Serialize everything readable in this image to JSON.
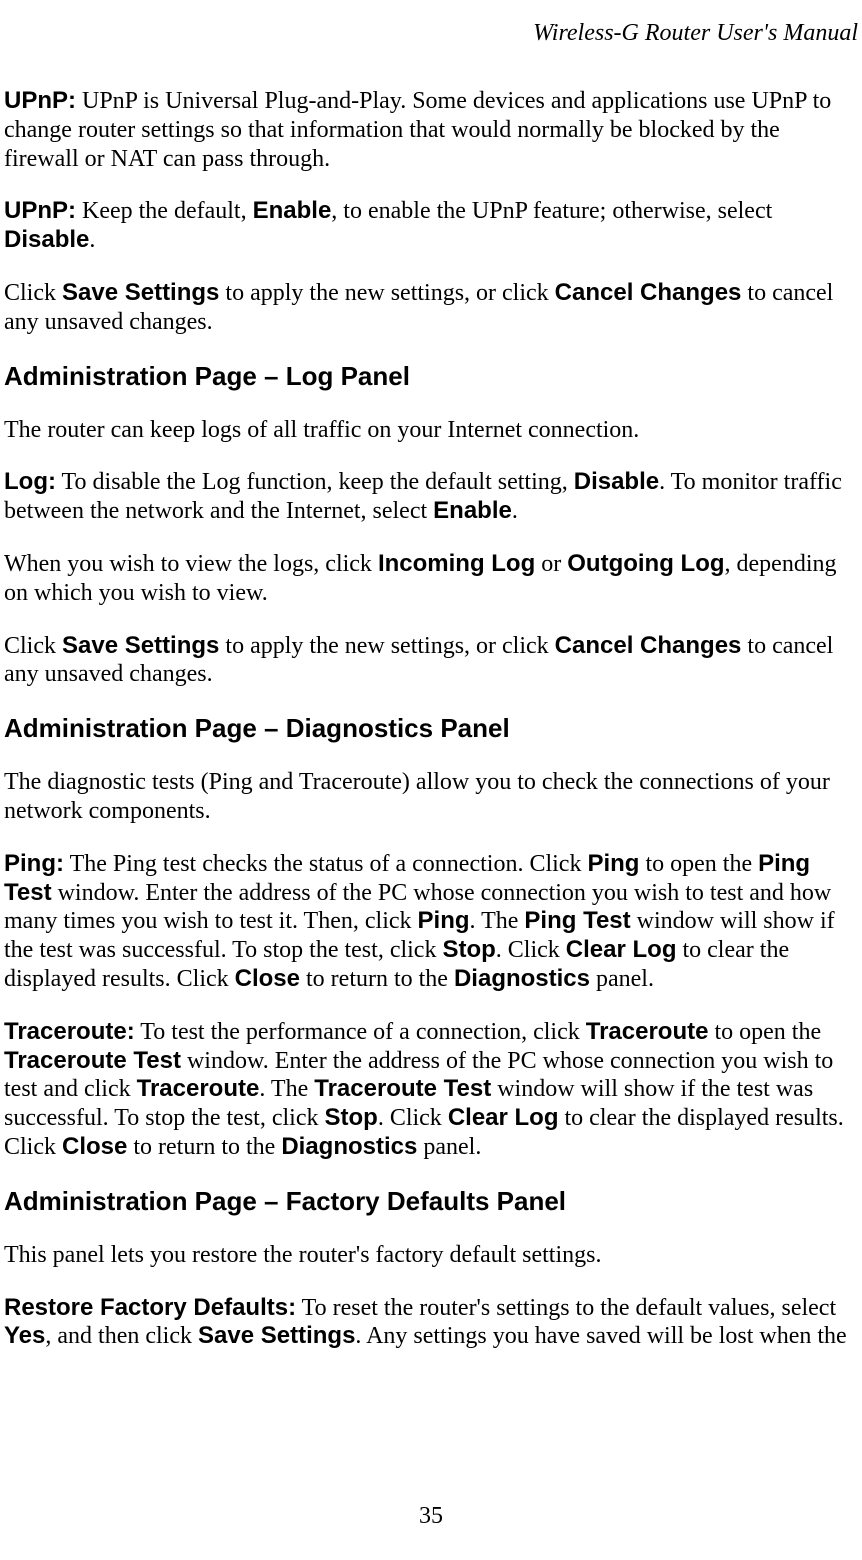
{
  "header": {
    "title": "Wireless-G Router User's Manual"
  },
  "paragraphs": {
    "p1": {
      "label": "UPnP:",
      "text": " UPnP is Universal Plug-and-Play. Some devices and applications use UPnP to change router settings so that information that would normally be blocked by the firewall or NAT can pass through."
    },
    "p2": {
      "label": "UPnP:",
      "t1": " Keep the default, ",
      "b1": "Enable",
      "t2": ", to enable the UPnP feature; otherwise, select ",
      "b2": "Disable",
      "t3": "."
    },
    "p3": {
      "t1": "Click ",
      "b1": "Save Settings",
      "t2": " to apply the new settings, or click ",
      "b2": "Cancel Changes",
      "t3": " to cancel any unsaved changes."
    },
    "h1": "Administration Page – Log Panel",
    "p4": "The router can keep logs of all traffic on your Internet connection.",
    "p5": {
      "label": "Log:",
      "t1": " To disable the Log function, keep the default setting, ",
      "b1": "Disable",
      "t2": ". To monitor traffic between the network and the Internet, select ",
      "b2": "Enable",
      "t3": "."
    },
    "p6": {
      "t1": "When you wish to view the logs, click ",
      "b1": "Incoming Log",
      "t2": " or ",
      "b2": "Outgoing Log",
      "t3": ", depending on which you wish to view."
    },
    "p7": {
      "t1": "Click ",
      "b1": "Save Settings",
      "t2": " to apply the new settings, or click ",
      "b2": "Cancel Changes",
      "t3": " to cancel any unsaved changes."
    },
    "h2": "Administration Page – Diagnostics Panel",
    "p8": "The diagnostic tests (Ping and Traceroute) allow you to check the connections of your network components.",
    "p9": {
      "label": "Ping:",
      "t1": " The Ping test checks the status of a connection. Click ",
      "b1": "Ping",
      "t2": " to open the ",
      "b2": "Ping Test",
      "t3": " window. Enter the address of the PC whose connection you wish to test and how many times you wish to test it. Then, click ",
      "b3": "Ping",
      "t4": ". The ",
      "b4": "Ping Test",
      "t5": " window will show if the test was successful. To stop the test, click ",
      "b5": "Stop",
      "t6": ". Click ",
      "b6": "Clear Log",
      "t7": " to clear the displayed results. Click ",
      "b7": "Close",
      "t8": " to return to the ",
      "b8": "Diagnostics",
      "t9": " panel."
    },
    "p10": {
      "label": "Traceroute:",
      "t1": " To test the performance of a connection, click ",
      "b1": "Traceroute",
      "t2": " to open the ",
      "b2": "Traceroute Test",
      "t3": " window. Enter the address of the PC whose connection you wish to test and click ",
      "b3": "Traceroute",
      "t4": ". The ",
      "b4": "Traceroute Test",
      "t5": " window will show if the test was successful. To stop the test, click ",
      "b5": "Stop",
      "t6": ". Click ",
      "b6": "Clear Log",
      "t7": " to clear the displayed results. Click ",
      "b7": "Close",
      "t8": " to return to the ",
      "b8": "Diagnostics",
      "t9": " panel."
    },
    "h3": "Administration Page – Factory Defaults Panel",
    "p11": "This panel lets you restore the router's factory default settings.",
    "p12": {
      "label": "Restore Factory Defaults:",
      "t1": " To reset the router's settings to the default values, select ",
      "b1": "Yes",
      "t2": ", and then click ",
      "b2": "Save Settings",
      "t3": ". Any settings you have saved will be lost when the"
    }
  },
  "footer": {
    "page_number": "35"
  }
}
